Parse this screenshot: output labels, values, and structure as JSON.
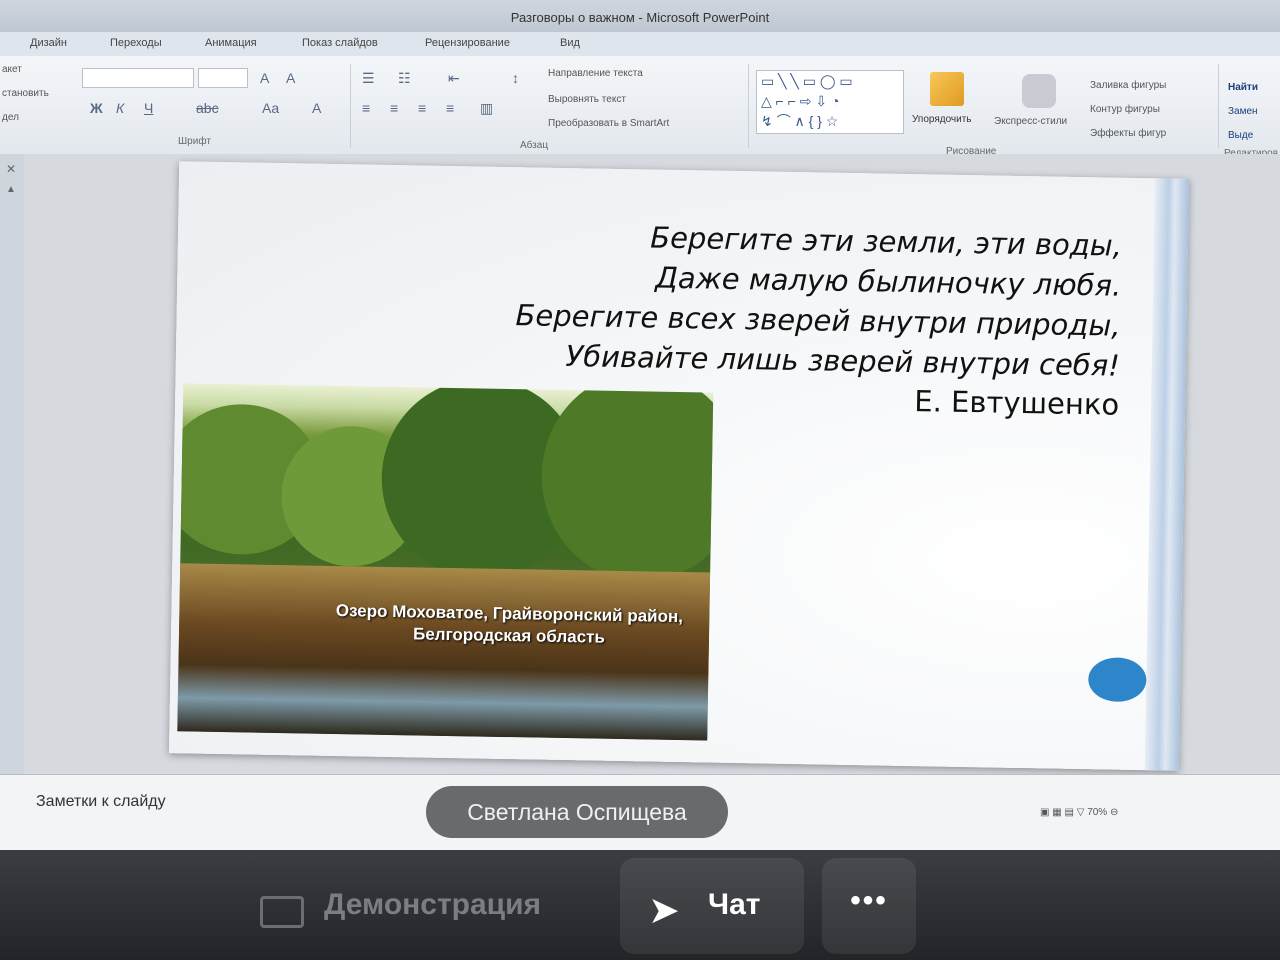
{
  "window": {
    "title": "Разговоры о важном - Microsoft PowerPoint"
  },
  "tabs": [
    "Дизайн",
    "Переходы",
    "Анимация",
    "Показ слайдов",
    "Рецензирование",
    "Вид"
  ],
  "ribbon": {
    "groups": {
      "font": "Шрифт",
      "paragraph": "Абзац",
      "drawing": "Рисование",
      "editing": "Редактиров"
    },
    "left_items": [
      "акет",
      "становить",
      "дел"
    ],
    "paragraph_items": [
      "Направление текста",
      "Выровнять текст",
      "Преобразовать в SmartArt"
    ],
    "drawing_buttons": {
      "arrange": "Упорядочить",
      "quick_styles": "Экспресс-стили"
    },
    "shape_items": [
      "Заливка фигуры",
      "Контур фигуры",
      "Эффекты фигур"
    ],
    "editing_items": [
      "Найти",
      "Замен",
      "Выде"
    ]
  },
  "slide": {
    "poem": [
      "Берегите эти земли, эти воды,",
      "Даже малую былиночку любя.",
      "Берегите всех зверей внутри природы,",
      "Убивайте лишь зверей внутри себя!"
    ],
    "author": "Е. Евтушенко",
    "caption_line1": "Озеро Моховатое, Грайворонский район,",
    "caption_line2": "Белгородская область",
    "accent_color": "#2c86c9"
  },
  "notes": {
    "placeholder": "Заметки к слайду"
  },
  "status": {
    "zoom": "70%"
  },
  "call": {
    "speaker": "Светлана Оспищева",
    "buttons": {
      "demo": "Демонстрация",
      "chat": "Чат",
      "more": "•••"
    }
  }
}
